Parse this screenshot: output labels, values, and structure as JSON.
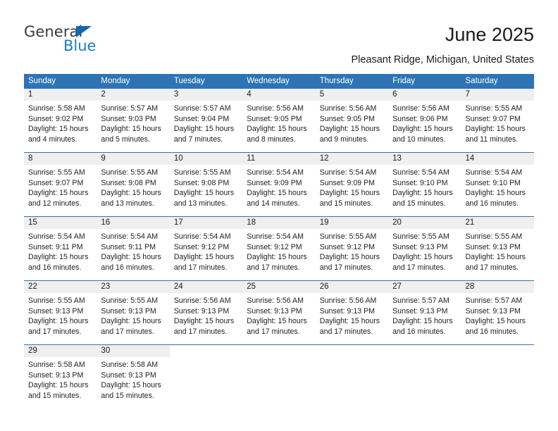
{
  "brand": {
    "name_top": "General",
    "name_bottom": "Blue",
    "accent_color": "#1c7cc4",
    "triangle_color": "#1069b0"
  },
  "header": {
    "title": "June 2025",
    "subtitle": "Pleasant Ridge, Michigan, United States",
    "header_bg_color": "#2e74b5",
    "daynum_bg_color": "#efefef"
  },
  "weekday_headers": [
    "Sunday",
    "Monday",
    "Tuesday",
    "Wednesday",
    "Thursday",
    "Friday",
    "Saturday"
  ],
  "labels": {
    "sunrise_prefix": "Sunrise:",
    "sunset_prefix": "Sunset:",
    "daylight_prefix": "Daylight:"
  },
  "weeks": [
    [
      {
        "day": "1",
        "sunrise": "Sunrise: 5:58 AM",
        "sunset": "Sunset: 9:02 PM",
        "daylight_1": "Daylight: 15 hours",
        "daylight_2": "and 4 minutes."
      },
      {
        "day": "2",
        "sunrise": "Sunrise: 5:57 AM",
        "sunset": "Sunset: 9:03 PM",
        "daylight_1": "Daylight: 15 hours",
        "daylight_2": "and 5 minutes."
      },
      {
        "day": "3",
        "sunrise": "Sunrise: 5:57 AM",
        "sunset": "Sunset: 9:04 PM",
        "daylight_1": "Daylight: 15 hours",
        "daylight_2": "and 7 minutes."
      },
      {
        "day": "4",
        "sunrise": "Sunrise: 5:56 AM",
        "sunset": "Sunset: 9:05 PM",
        "daylight_1": "Daylight: 15 hours",
        "daylight_2": "and 8 minutes."
      },
      {
        "day": "5",
        "sunrise": "Sunrise: 5:56 AM",
        "sunset": "Sunset: 9:05 PM",
        "daylight_1": "Daylight: 15 hours",
        "daylight_2": "and 9 minutes."
      },
      {
        "day": "6",
        "sunrise": "Sunrise: 5:56 AM",
        "sunset": "Sunset: 9:06 PM",
        "daylight_1": "Daylight: 15 hours",
        "daylight_2": "and 10 minutes."
      },
      {
        "day": "7",
        "sunrise": "Sunrise: 5:55 AM",
        "sunset": "Sunset: 9:07 PM",
        "daylight_1": "Daylight: 15 hours",
        "daylight_2": "and 11 minutes."
      }
    ],
    [
      {
        "day": "8",
        "sunrise": "Sunrise: 5:55 AM",
        "sunset": "Sunset: 9:07 PM",
        "daylight_1": "Daylight: 15 hours",
        "daylight_2": "and 12 minutes."
      },
      {
        "day": "9",
        "sunrise": "Sunrise: 5:55 AM",
        "sunset": "Sunset: 9:08 PM",
        "daylight_1": "Daylight: 15 hours",
        "daylight_2": "and 13 minutes."
      },
      {
        "day": "10",
        "sunrise": "Sunrise: 5:55 AM",
        "sunset": "Sunset: 9:08 PM",
        "daylight_1": "Daylight: 15 hours",
        "daylight_2": "and 13 minutes."
      },
      {
        "day": "11",
        "sunrise": "Sunrise: 5:54 AM",
        "sunset": "Sunset: 9:09 PM",
        "daylight_1": "Daylight: 15 hours",
        "daylight_2": "and 14 minutes."
      },
      {
        "day": "12",
        "sunrise": "Sunrise: 5:54 AM",
        "sunset": "Sunset: 9:09 PM",
        "daylight_1": "Daylight: 15 hours",
        "daylight_2": "and 15 minutes."
      },
      {
        "day": "13",
        "sunrise": "Sunrise: 5:54 AM",
        "sunset": "Sunset: 9:10 PM",
        "daylight_1": "Daylight: 15 hours",
        "daylight_2": "and 15 minutes."
      },
      {
        "day": "14",
        "sunrise": "Sunrise: 5:54 AM",
        "sunset": "Sunset: 9:10 PM",
        "daylight_1": "Daylight: 15 hours",
        "daylight_2": "and 16 minutes."
      }
    ],
    [
      {
        "day": "15",
        "sunrise": "Sunrise: 5:54 AM",
        "sunset": "Sunset: 9:11 PM",
        "daylight_1": "Daylight: 15 hours",
        "daylight_2": "and 16 minutes."
      },
      {
        "day": "16",
        "sunrise": "Sunrise: 5:54 AM",
        "sunset": "Sunset: 9:11 PM",
        "daylight_1": "Daylight: 15 hours",
        "daylight_2": "and 16 minutes."
      },
      {
        "day": "17",
        "sunrise": "Sunrise: 5:54 AM",
        "sunset": "Sunset: 9:12 PM",
        "daylight_1": "Daylight: 15 hours",
        "daylight_2": "and 17 minutes."
      },
      {
        "day": "18",
        "sunrise": "Sunrise: 5:54 AM",
        "sunset": "Sunset: 9:12 PM",
        "daylight_1": "Daylight: 15 hours",
        "daylight_2": "and 17 minutes."
      },
      {
        "day": "19",
        "sunrise": "Sunrise: 5:55 AM",
        "sunset": "Sunset: 9:12 PM",
        "daylight_1": "Daylight: 15 hours",
        "daylight_2": "and 17 minutes."
      },
      {
        "day": "20",
        "sunrise": "Sunrise: 5:55 AM",
        "sunset": "Sunset: 9:13 PM",
        "daylight_1": "Daylight: 15 hours",
        "daylight_2": "and 17 minutes."
      },
      {
        "day": "21",
        "sunrise": "Sunrise: 5:55 AM",
        "sunset": "Sunset: 9:13 PM",
        "daylight_1": "Daylight: 15 hours",
        "daylight_2": "and 17 minutes."
      }
    ],
    [
      {
        "day": "22",
        "sunrise": "Sunrise: 5:55 AM",
        "sunset": "Sunset: 9:13 PM",
        "daylight_1": "Daylight: 15 hours",
        "daylight_2": "and 17 minutes."
      },
      {
        "day": "23",
        "sunrise": "Sunrise: 5:55 AM",
        "sunset": "Sunset: 9:13 PM",
        "daylight_1": "Daylight: 15 hours",
        "daylight_2": "and 17 minutes."
      },
      {
        "day": "24",
        "sunrise": "Sunrise: 5:56 AM",
        "sunset": "Sunset: 9:13 PM",
        "daylight_1": "Daylight: 15 hours",
        "daylight_2": "and 17 minutes."
      },
      {
        "day": "25",
        "sunrise": "Sunrise: 5:56 AM",
        "sunset": "Sunset: 9:13 PM",
        "daylight_1": "Daylight: 15 hours",
        "daylight_2": "and 17 minutes."
      },
      {
        "day": "26",
        "sunrise": "Sunrise: 5:56 AM",
        "sunset": "Sunset: 9:13 PM",
        "daylight_1": "Daylight: 15 hours",
        "daylight_2": "and 17 minutes."
      },
      {
        "day": "27",
        "sunrise": "Sunrise: 5:57 AM",
        "sunset": "Sunset: 9:13 PM",
        "daylight_1": "Daylight: 15 hours",
        "daylight_2": "and 16 minutes."
      },
      {
        "day": "28",
        "sunrise": "Sunrise: 5:57 AM",
        "sunset": "Sunset: 9:13 PM",
        "daylight_1": "Daylight: 15 hours",
        "daylight_2": "and 16 minutes."
      }
    ],
    [
      {
        "day": "29",
        "sunrise": "Sunrise: 5:58 AM",
        "sunset": "Sunset: 9:13 PM",
        "daylight_1": "Daylight: 15 hours",
        "daylight_2": "and 15 minutes."
      },
      {
        "day": "30",
        "sunrise": "Sunrise: 5:58 AM",
        "sunset": "Sunset: 9:13 PM",
        "daylight_1": "Daylight: 15 hours",
        "daylight_2": "and 15 minutes."
      },
      {
        "day": "",
        "sunrise": "",
        "sunset": "",
        "daylight_1": "",
        "daylight_2": ""
      },
      {
        "day": "",
        "sunrise": "",
        "sunset": "",
        "daylight_1": "",
        "daylight_2": ""
      },
      {
        "day": "",
        "sunrise": "",
        "sunset": "",
        "daylight_1": "",
        "daylight_2": ""
      },
      {
        "day": "",
        "sunrise": "",
        "sunset": "",
        "daylight_1": "",
        "daylight_2": ""
      },
      {
        "day": "",
        "sunrise": "",
        "sunset": "",
        "daylight_1": "",
        "daylight_2": ""
      }
    ]
  ]
}
